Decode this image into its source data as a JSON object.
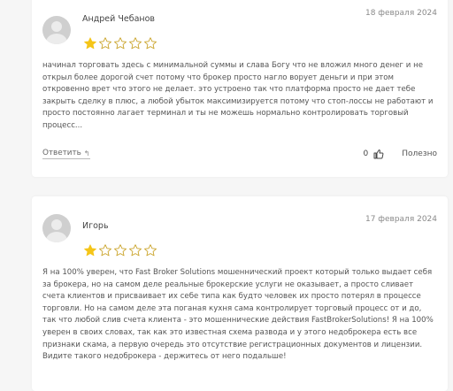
{
  "reviews": [
    {
      "author": "Андрей Чебанов",
      "date": "18 февраля 2024",
      "rating": 1,
      "max_rating": 5,
      "text": "начинал торговать здесь с минимальной суммы и слава Богу что не вложил много денег и не открыл более дорогой счет потому что брокер просто нагло ворует деньги и при этом откровенно врет что этого не делает. это устроено так что платформа просто не дает тебе закрыть сделку в плюс, а любой убыток максимизируется потому что стоп-лоссы не работают и просто постоянно лагает терминал и ты не можешь нормально контролировать торговый процесс...",
      "reply_label": "Ответить",
      "likes_count": "0",
      "useful_label": "Полезно"
    },
    {
      "author": "Игорь",
      "date": "17 февраля 2024",
      "rating": 1,
      "max_rating": 5,
      "text": "Я на 100% уверен, что Fast Broker Solutions мошеннический проект который только выдает себя за брокера, но на самом деле реальные брокерские услуги не оказывает, а просто сливает счета клиентов и присваивает их себе типа как будто человек их просто потерял в процессе торговли. Но на самом деле эта поганая кухня сама контролирует торговый процесс от и до, так что любой слив счета клиента - это мошеннические действия FastBrokerSolutions! Я на 100% уверен в своих словах, так как это известная схема развода и у этого недоброкера есть все признаки скама, а первую очередь это отсутствие регистрационных документов и лицензии. Видите такого недоброкера - держитесь от него подальше!"
    }
  ],
  "colors": {
    "star_filled": "#f5c518",
    "star_empty": "#c9a227",
    "card_bg": "#ffffff",
    "page_bg": "#f6f6f6"
  },
  "icons": {
    "avatar": "user-avatar-icon",
    "star": "star-icon",
    "reply": "reply-arrow-icon",
    "like": "thumbs-up-icon"
  }
}
